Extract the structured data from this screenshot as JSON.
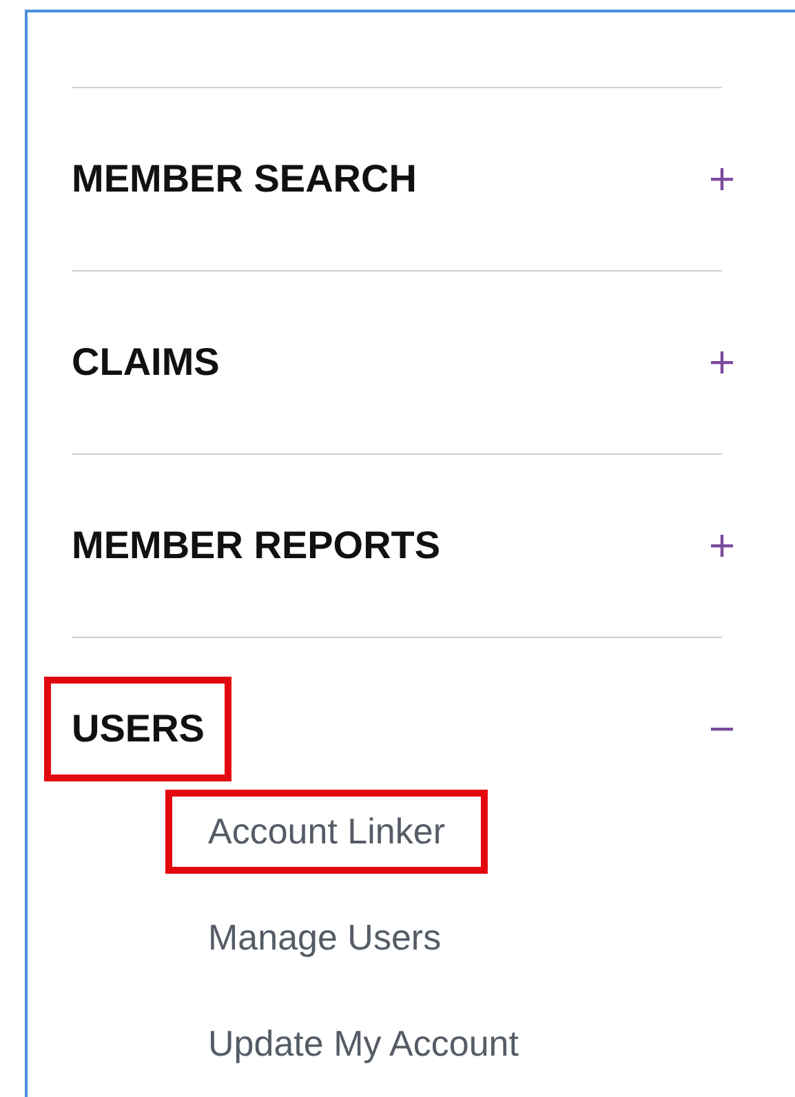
{
  "menu": [
    {
      "label": "MEMBER SEARCH",
      "expanded": false,
      "highlighted": false
    },
    {
      "label": "CLAIMS",
      "expanded": false,
      "highlighted": false
    },
    {
      "label": "MEMBER REPORTS",
      "expanded": false,
      "highlighted": false
    },
    {
      "label": "USERS",
      "expanded": true,
      "highlighted": true,
      "children": [
        {
          "label": "Account Linker",
          "highlighted": true
        },
        {
          "label": "Manage Users",
          "highlighted": false
        },
        {
          "label": "Update My Account",
          "highlighted": false
        }
      ]
    }
  ]
}
